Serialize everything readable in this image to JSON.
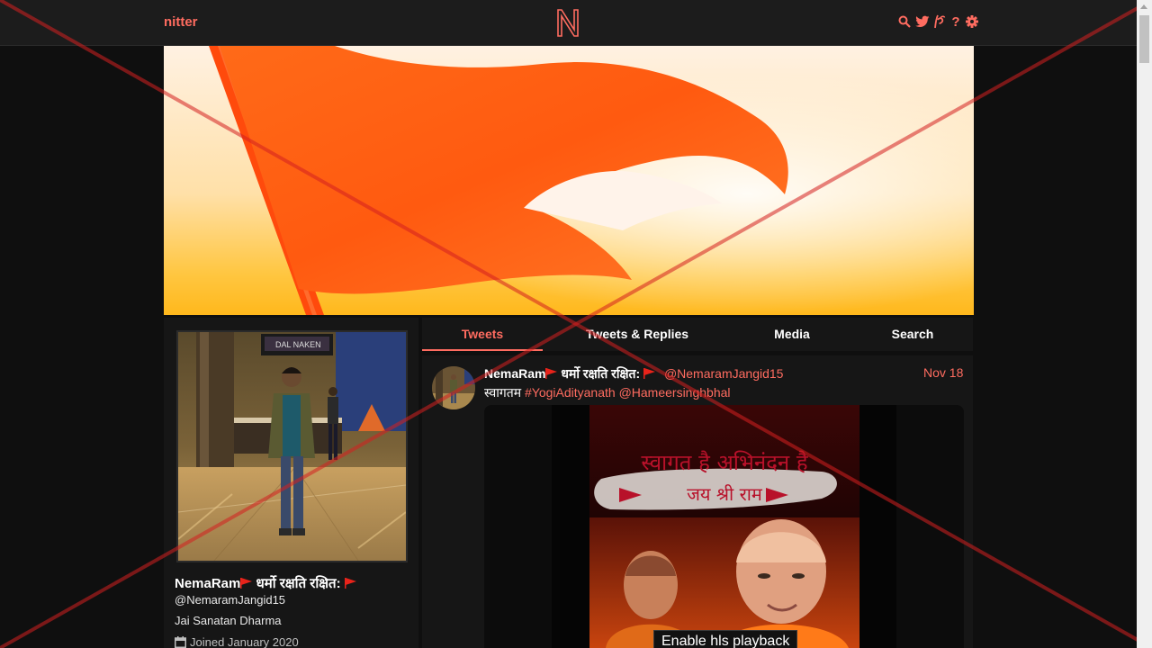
{
  "nav": {
    "brand": "nitter",
    "icons": [
      "search-icon",
      "twitter-bird-icon",
      "rss-icon",
      "help-icon",
      "gear-icon"
    ],
    "help_glyph": "?"
  },
  "profile": {
    "fullname": "NemaRam",
    "fullname_motto": " धर्मो रक्षति रक्षित: ",
    "username": "@NemaramJangid15",
    "bio": "Jai Sanatan Dharma",
    "joined": "Joined January 2020"
  },
  "tabs": [
    {
      "label": "Tweets",
      "active": true
    },
    {
      "label": "Tweets & Replies",
      "active": false
    },
    {
      "label": "Media",
      "active": false
    },
    {
      "label": "Search",
      "active": false
    }
  ],
  "tweet": {
    "fullname": "NemaRam",
    "fullname_motto": " धर्मो रक्षति रक्षित: ",
    "username": "@NemaramJangid15",
    "date": "Nov 18",
    "text_prefix": "स्वागतम ",
    "hashtag": "#YogiAdityanath",
    "mention": "@Hameersinghbhal",
    "media_overlay_line1": "स्वागत है अभिनंदन है",
    "media_overlay_line2": "जय श्री राम",
    "hls_button": "Enable hls playback"
  },
  "colors": {
    "accent": "#ff6c60",
    "background": "#0f0f0f",
    "panel": "#161616",
    "nav": "#1c1c1c",
    "saffron": "#ff5a12"
  }
}
